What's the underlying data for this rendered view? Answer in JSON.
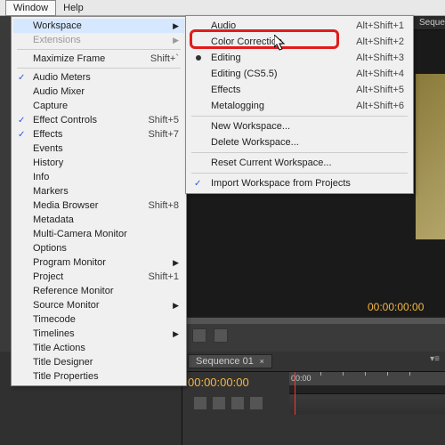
{
  "menubar": {
    "window": "Window",
    "help": "Help"
  },
  "dropdown": {
    "workspace": "Workspace",
    "extensions": "Extensions",
    "maximize_frame": "Maximize Frame",
    "maximize_shortcut": "Shift+`",
    "audio_meters": "Audio Meters",
    "audio_mixer": "Audio Mixer",
    "capture": "Capture",
    "effect_controls": "Effect Controls",
    "effect_controls_shortcut": "Shift+5",
    "effects": "Effects",
    "effects_shortcut": "Shift+7",
    "events": "Events",
    "history": "History",
    "info": "Info",
    "markers": "Markers",
    "media_browser": "Media Browser",
    "media_browser_shortcut": "Shift+8",
    "metadata": "Metadata",
    "multi_camera_monitor": "Multi-Camera Monitor",
    "options": "Options",
    "program_monitor": "Program Monitor",
    "project": "Project",
    "project_shortcut": "Shift+1",
    "reference_monitor": "Reference Monitor",
    "source_monitor": "Source Monitor",
    "timecode": "Timecode",
    "timelines": "Timelines",
    "title_actions": "Title Actions",
    "title_designer": "Title Designer",
    "title_properties": "Title Properties"
  },
  "submenu": {
    "audio": {
      "label": "Audio",
      "shortcut": "Alt+Shift+1"
    },
    "color_correction": {
      "label": "Color Correction",
      "shortcut": "Alt+Shift+2"
    },
    "editing": {
      "label": "Editing",
      "shortcut": "Alt+Shift+3"
    },
    "editing55": {
      "label": "Editing (CS5.5)",
      "shortcut": "Alt+Shift+4"
    },
    "effects": {
      "label": "Effects",
      "shortcut": "Alt+Shift+5"
    },
    "metalogging": {
      "label": "Metalogging",
      "shortcut": "Alt+Shift+6"
    },
    "new_workspace": "New Workspace...",
    "delete_workspace": "Delete Workspace...",
    "reset_workspace": "Reset Current Workspace...",
    "import_workspace": "Import Workspace from Projects"
  },
  "panels": {
    "sequence_header": "Sequence",
    "sequence_tab": "Sequence 01",
    "timecode_main": "00:00:00:00",
    "timecode_small": "00:00:00:00",
    "tick0": "00:00"
  }
}
